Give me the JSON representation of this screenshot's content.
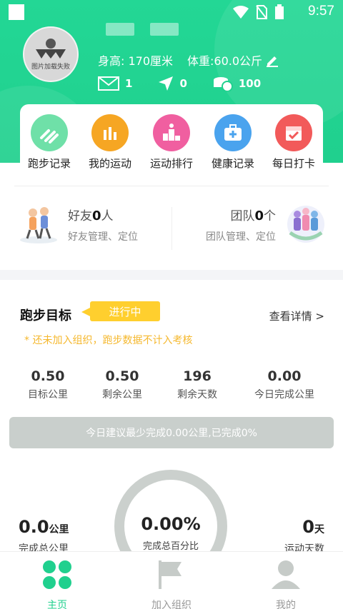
{
  "status_bar": {
    "time": "9:57"
  },
  "profile": {
    "avatar_text": "图片加载失败",
    "height": "身高: 170厘米",
    "weight": "体重:60.0公斤",
    "messages": "1",
    "location": "0",
    "coins": "100"
  },
  "features": [
    {
      "label": "跑步记录",
      "icon": "running-icon",
      "color": "#6fe0a8"
    },
    {
      "label": "我的运动",
      "icon": "bar-chart-icon",
      "color": "#f6a623"
    },
    {
      "label": "运动排行",
      "icon": "podium-icon",
      "color": "#f05fa0"
    },
    {
      "label": "健康记录",
      "icon": "medical-kit-icon",
      "color": "#4aa3ee"
    },
    {
      "label": "每日打卡",
      "icon": "calendar-check-icon",
      "color": "#f25a5a"
    }
  ],
  "social": {
    "friends_label": "好友",
    "friends_count": "0",
    "friends_unit": "人",
    "friends_sub": "好友管理、定位",
    "team_label": "团队",
    "team_count": "0",
    "team_unit": "个",
    "team_sub": "团队管理、定位"
  },
  "goal": {
    "title": "跑步目标",
    "badge": "进行中",
    "detail": "查看详情 >",
    "notice": "* 还未加入组织，跑步数据不计入考核",
    "metrics": [
      {
        "value": "0.50",
        "label": "目标公里"
      },
      {
        "value": "0.50",
        "label": "剩余公里"
      },
      {
        "value": "196",
        "label": "剩余天数"
      },
      {
        "value": "0.00",
        "label": "今日完成公里"
      }
    ],
    "suggestion": "今日建议最少完成0.00公里,已完成0%",
    "total_km": "0.0",
    "total_km_unit": "公里",
    "total_km_label": "完成总公里",
    "percent": "0.00%",
    "percent_label": "完成总百分比",
    "days": "0",
    "days_unit": "天",
    "days_label": "运动天数"
  },
  "tabs": [
    {
      "label": "主页",
      "active": true
    },
    {
      "label": "加入组织",
      "active": false
    },
    {
      "label": "我的",
      "active": false
    }
  ],
  "colors": {
    "brand": "#20d08e",
    "accent_yellow": "#ffcf2e"
  }
}
